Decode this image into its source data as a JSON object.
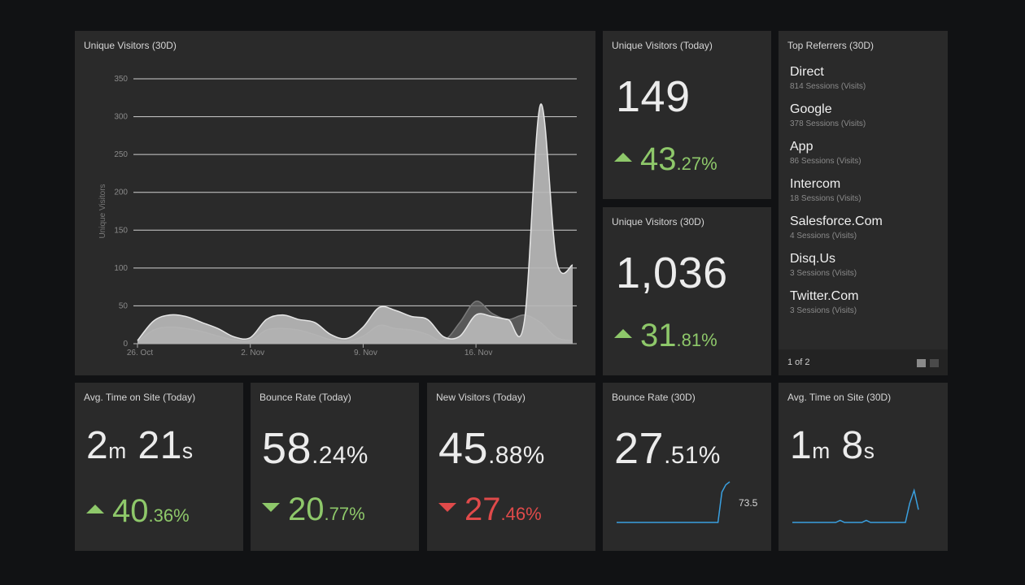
{
  "colors": {
    "background": "#111214",
    "panel": "#2a2a2a",
    "positive": "#8ec86a",
    "negative": "#e04a4a",
    "sparkline": "#3aa0e0"
  },
  "main_chart": {
    "title": "Unique Visitors (30D)"
  },
  "chart_data": {
    "type": "area",
    "ylabel": "Unique Visitors",
    "xlabel": "",
    "ylim": [
      0,
      350
    ],
    "yticks": [
      0,
      50,
      100,
      150,
      200,
      250,
      300,
      350
    ],
    "xticks": [
      {
        "label": "26. Oct",
        "day": 0
      },
      {
        "label": "2. Nov",
        "day": 7
      },
      {
        "label": "9. Nov",
        "day": 14
      },
      {
        "label": "16. Nov",
        "day": 21
      }
    ],
    "grid": true,
    "series": [
      {
        "values": [
          4,
          30,
          38,
          36,
          28,
          20,
          9,
          8,
          32,
          38,
          32,
          28,
          12,
          7,
          22,
          48,
          44,
          36,
          32,
          9,
          10,
          38,
          36,
          32,
          30,
          316,
          110,
          104
        ]
      },
      {
        "values": [
          2,
          18,
          22,
          20,
          16,
          10,
          5,
          4,
          18,
          20,
          18,
          12,
          5,
          3,
          10,
          24,
          20,
          18,
          12,
          4,
          28,
          56,
          40,
          32,
          38,
          28,
          8,
          4
        ]
      }
    ]
  },
  "today_visitors": {
    "title": "Unique Visitors (Today)",
    "value": "149",
    "delta_int": "43",
    "delta_dec": ".27%"
  },
  "month_visitors": {
    "title": "Unique Visitors (30D)",
    "value": "1,036",
    "delta_int": "31",
    "delta_dec": ".81%"
  },
  "referrers": {
    "title": "Top Referrers (30D)",
    "items": [
      {
        "name": "Direct",
        "sessions": "814 Sessions (Visits)"
      },
      {
        "name": "Google",
        "sessions": "378 Sessions (Visits)"
      },
      {
        "name": "App",
        "sessions": "86 Sessions (Visits)"
      },
      {
        "name": "Intercom",
        "sessions": "18 Sessions (Visits)"
      },
      {
        "name": "Salesforce.Com",
        "sessions": "4 Sessions (Visits)"
      },
      {
        "name": "Disq.Us",
        "sessions": "3 Sessions (Visits)"
      },
      {
        "name": "Twitter.Com",
        "sessions": "3 Sessions (Visits)"
      }
    ],
    "page_label": "1 of 2",
    "current_page": 1,
    "total_pages": 2
  },
  "avg_time_today": {
    "title": "Avg. Time on Site (Today)",
    "minutes": "2",
    "m_unit": "m",
    "seconds": "21",
    "s_unit": "s",
    "delta_int": "40",
    "delta_dec": ".36%"
  },
  "bounce_today": {
    "title": "Bounce Rate (Today)",
    "int": "58",
    "dec": ".24%",
    "delta_int": "20",
    "delta_dec": ".77%"
  },
  "new_visitors_today": {
    "title": "New Visitors (Today)",
    "int": "45",
    "dec": ".88%",
    "delta_int": "27",
    "delta_dec": ".46%"
  },
  "bounce_30d": {
    "title": "Bounce Rate (30D)",
    "int": "27",
    "dec": ".51%",
    "last_label": "73.5",
    "spark": [
      0,
      0,
      0,
      0,
      0,
      0,
      0,
      0,
      0,
      0,
      0,
      0,
      0,
      0,
      0,
      0,
      0,
      0,
      0,
      0,
      0,
      0,
      0,
      0,
      0,
      0,
      0,
      55,
      68,
      73.5
    ],
    "spark_max": 73.5
  },
  "avg_time_30d": {
    "title": "Avg. Time on Site (30D)",
    "minutes": "1",
    "m_unit": "m",
    "seconds": "8",
    "s_unit": "s",
    "spark": [
      0,
      0,
      0,
      0,
      0,
      0,
      0,
      0,
      0,
      0,
      0,
      2,
      0,
      0,
      0,
      0,
      0,
      2,
      0,
      0,
      0,
      0,
      0,
      0,
      0,
      0,
      0,
      18,
      30,
      12
    ],
    "spark_max": 32
  }
}
